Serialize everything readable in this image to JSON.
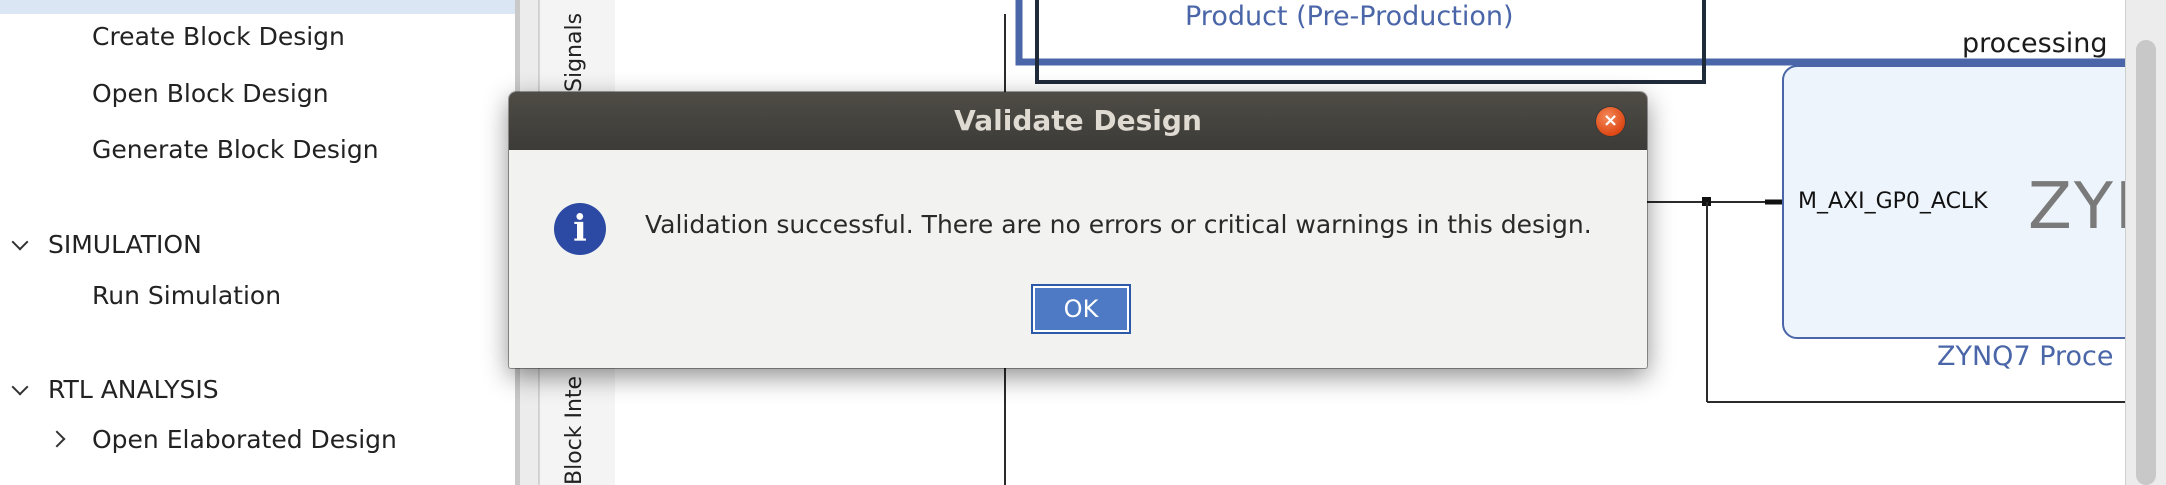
{
  "flow_navigator": {
    "ip_integrator_items": [
      "Create Block Design",
      "Open Block Design",
      "Generate Block Design"
    ],
    "simulation": {
      "header": "SIMULATION",
      "items": [
        "Run Simulation"
      ]
    },
    "rtl_analysis": {
      "header": "RTL ANALYSIS",
      "items": [
        "Open Elaborated Design"
      ]
    }
  },
  "side_tabs": [
    "Signals",
    "Block Inte"
  ],
  "diagram": {
    "banner_text": "Product (Pre-Production)",
    "processing_label": "processing",
    "port_label": "M_AXI_GP0_ACLK",
    "logo_text": "ZYN",
    "ip_title": "ZYNQ7 Proce"
  },
  "dialog": {
    "title": "Validate Design",
    "close_symbol": "×",
    "icon_symbol": "i",
    "message": "Validation successful. There are no errors or critical warnings in this design.",
    "ok_label": "OK"
  },
  "colors": {
    "title_bar": "#3c3b37",
    "close_button": "#dd4814",
    "info_icon": "#2c4aa3",
    "ok_button": "#4e79c4",
    "diagram_blue": "#4a66a8",
    "ip_block_fill": "#eef4fc"
  }
}
